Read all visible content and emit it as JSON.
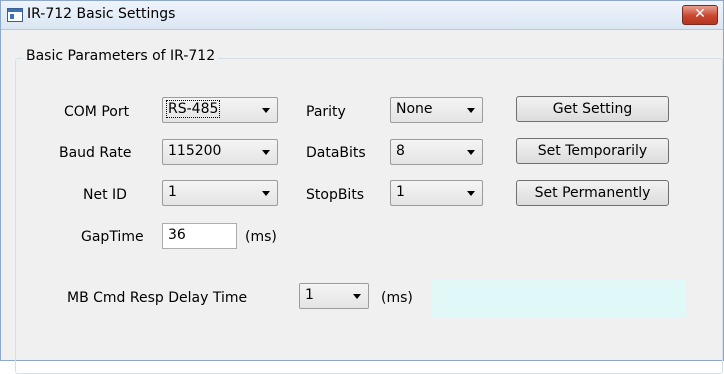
{
  "window": {
    "title": "IR-712 Basic Settings",
    "close_label": "✕"
  },
  "group": {
    "title": "Basic Parameters of IR-712"
  },
  "fields": {
    "com_port": {
      "label": "COM Port",
      "value": "RS-485"
    },
    "baud_rate": {
      "label": "Baud Rate",
      "value": "115200"
    },
    "net_id": {
      "label": "Net ID",
      "value": "1"
    },
    "parity": {
      "label": "Parity",
      "value": "None"
    },
    "databits": {
      "label": "DataBits",
      "value": "8"
    },
    "stopbits": {
      "label": "StopBits",
      "value": "1"
    },
    "gaptime": {
      "label": "GapTime",
      "value": "36",
      "unit": "(ms)"
    },
    "mb_delay": {
      "label": "MB Cmd Resp Delay Time",
      "value": "1",
      "unit": "(ms)"
    }
  },
  "buttons": {
    "get_setting": "Get Setting",
    "set_temporarily": "Set Temporarily",
    "set_permanently": "Set Permanently"
  },
  "colors": {
    "status_box": "#e0f8f8",
    "close_button": "#c9462f"
  },
  "icons": [
    "app-window-icon",
    "close-icon",
    "dropdown-arrow-icon"
  ]
}
